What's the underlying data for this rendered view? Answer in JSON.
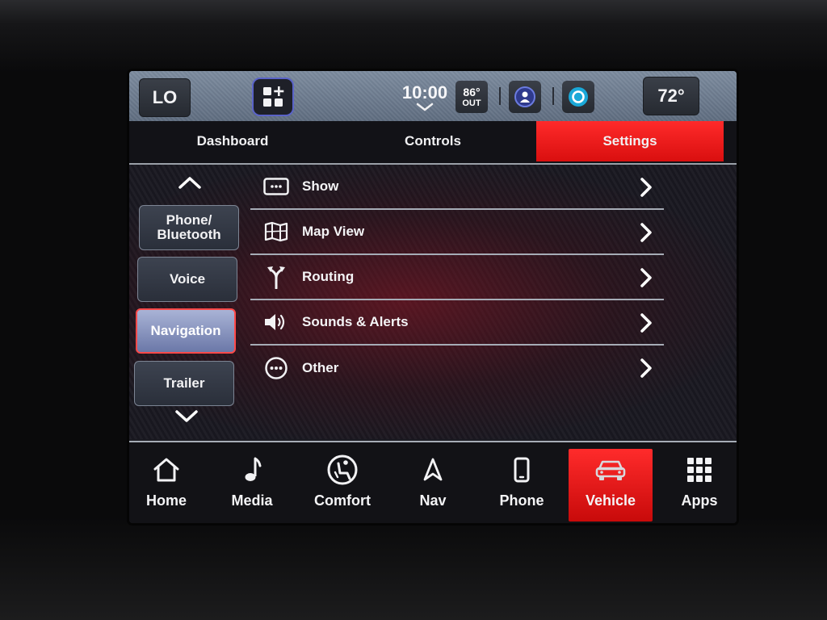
{
  "status_bar": {
    "left_temp": "LO",
    "right_temp": "72°",
    "clock": "10:00",
    "outside_temp": "86°",
    "outside_label": "OUT"
  },
  "tabs": [
    {
      "label": "Dashboard"
    },
    {
      "label": "Controls"
    },
    {
      "label": "Settings",
      "active": true
    }
  ],
  "sidebar": {
    "items": [
      {
        "label": "Phone/ Bluetooth"
      },
      {
        "label": "Voice"
      },
      {
        "label": "Navigation",
        "active": true
      },
      {
        "label": "Trailer"
      }
    ]
  },
  "settings_list": [
    {
      "label": "Show",
      "icon": "display-icon"
    },
    {
      "label": "Map View",
      "icon": "map-icon"
    },
    {
      "label": "Routing",
      "icon": "route-split-icon"
    },
    {
      "label": "Sounds & Alerts",
      "icon": "speaker-icon"
    },
    {
      "label": "Other",
      "icon": "more-dots-icon"
    }
  ],
  "bottom_nav": [
    {
      "label": "Home",
      "icon": "home-icon"
    },
    {
      "label": "Media",
      "icon": "music-note-icon"
    },
    {
      "label": "Comfort",
      "icon": "seat-comfort-icon"
    },
    {
      "label": "Nav",
      "icon": "nav-arrow-icon"
    },
    {
      "label": "Phone",
      "icon": "phone-icon"
    },
    {
      "label": "Vehicle",
      "icon": "car-icon",
      "active": true
    },
    {
      "label": "Apps",
      "icon": "apps-grid-icon"
    }
  ],
  "colors": {
    "accent_red": "#e8191b",
    "status_bar": "#6e7d90",
    "active_side_button": "#8b96c0"
  }
}
